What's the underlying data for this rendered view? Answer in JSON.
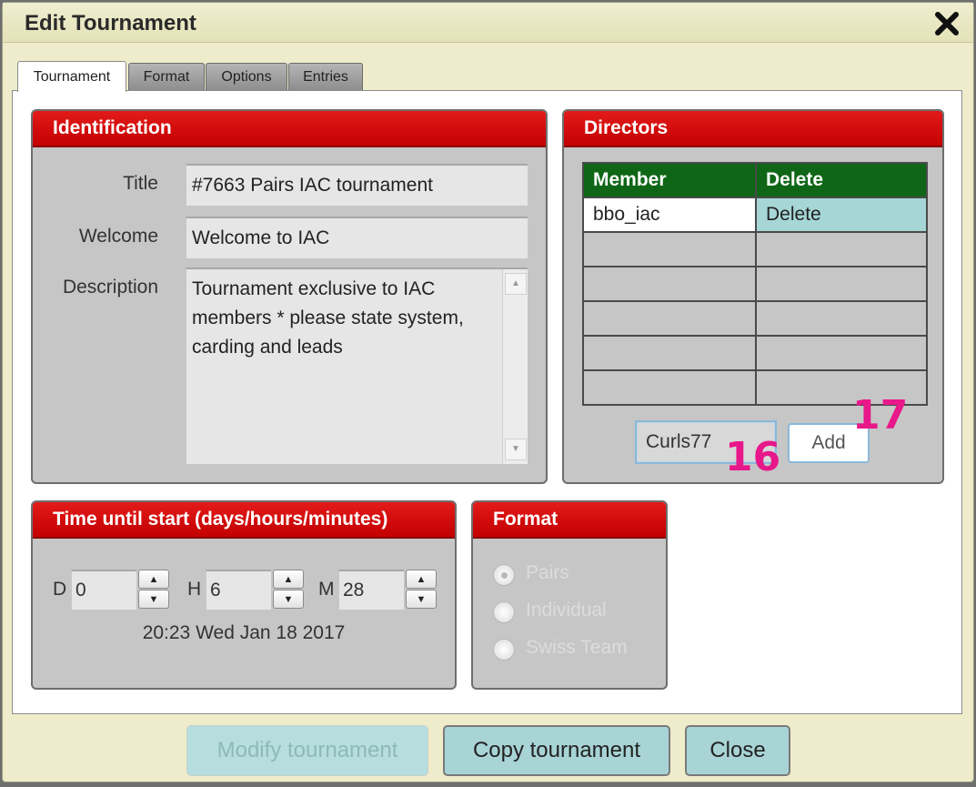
{
  "dialog": {
    "title": "Edit Tournament",
    "close_icon": "close-x-icon"
  },
  "tabs": [
    {
      "label": "Tournament",
      "active": true
    },
    {
      "label": "Format",
      "active": false
    },
    {
      "label": "Options",
      "active": false
    },
    {
      "label": "Entries",
      "active": false
    }
  ],
  "identification": {
    "heading": "Identification",
    "title_label": "Title",
    "title_value": "#7663 Pairs IAC tournament",
    "welcome_label": "Welcome",
    "welcome_value": "Welcome to IAC",
    "description_label": "Description",
    "description_lines": [
      "Tournament exclusive to IAC",
      "members * please state system,",
      "carding and leads"
    ]
  },
  "directors": {
    "heading": "Directors",
    "columns": [
      "Member",
      "Delete"
    ],
    "rows": [
      {
        "member": "bbo_iac",
        "delete": "Delete"
      }
    ],
    "member_input_value": "Curls77",
    "add_label": "Add"
  },
  "annotations": {
    "input_marker": "16",
    "add_marker": "17"
  },
  "time_until_start": {
    "heading": "Time until start (days/hours/minutes)",
    "days_label": "D",
    "days_value": "0",
    "hours_label": "H",
    "hours_value": "6",
    "minutes_label": "M",
    "minutes_value": "28",
    "start_datetime": "20:23 Wed Jan 18 2017"
  },
  "format": {
    "heading": "Format",
    "options": [
      {
        "label": "Pairs",
        "selected": true
      },
      {
        "label": "Individual",
        "selected": false
      },
      {
        "label": "Swiss Team",
        "selected": false
      }
    ],
    "disabled": true
  },
  "buttons": {
    "modify": "Modify tournament",
    "copy": "Copy tournament",
    "close": "Close"
  },
  "colors": {
    "panel_header": "#d40000",
    "table_header": "#0f6616",
    "delete_cell": "#a6d6d6",
    "annotation": "#e8178a",
    "button": "#a8d4d6"
  }
}
